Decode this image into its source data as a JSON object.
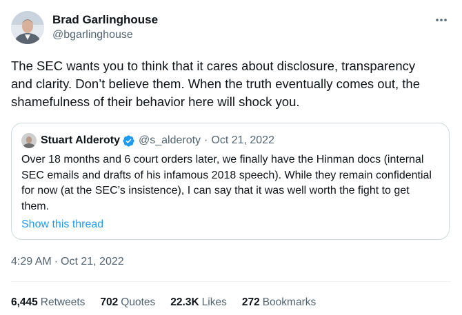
{
  "author": {
    "display_name": "Brad Garlinghouse",
    "handle": "@bgarlinghouse"
  },
  "tweet": {
    "text": "The SEC wants you to think that it cares about disclosure, transparency\nand clarity. Don’t believe them. When the truth eventually comes out, the\nshamefulness of their behavior here will shock you.",
    "time": "4:29 AM",
    "separator": "·",
    "date": "Oct 21, 2022"
  },
  "quoted": {
    "display_name": "Stuart Alderoty",
    "handle": "@s_alderoty",
    "separator": "·",
    "date": "Oct 21, 2022",
    "text": "Over 18 months and 6 court orders later, we finally have the Hinman docs (internal SEC emails and drafts of his infamous 2018 speech). While they remain confidential for now (at the SEC’s insistence), I can say that it was well worth the fight to get them.",
    "show_thread": "Show this thread",
    "verified_color": "#1d9bf0"
  },
  "stats": [
    {
      "count": "6,445",
      "label": "Retweets"
    },
    {
      "count": "702",
      "label": "Quotes"
    },
    {
      "count": "22.3K",
      "label": "Likes"
    },
    {
      "count": "272",
      "label": "Bookmarks"
    }
  ],
  "icons": {
    "more": "more-horizontal-icon",
    "verified": "verified-badge-icon"
  },
  "colors": {
    "text": "#0f1419",
    "secondary": "#536471",
    "link": "#1d9bf0",
    "border": "#cfd9de"
  }
}
